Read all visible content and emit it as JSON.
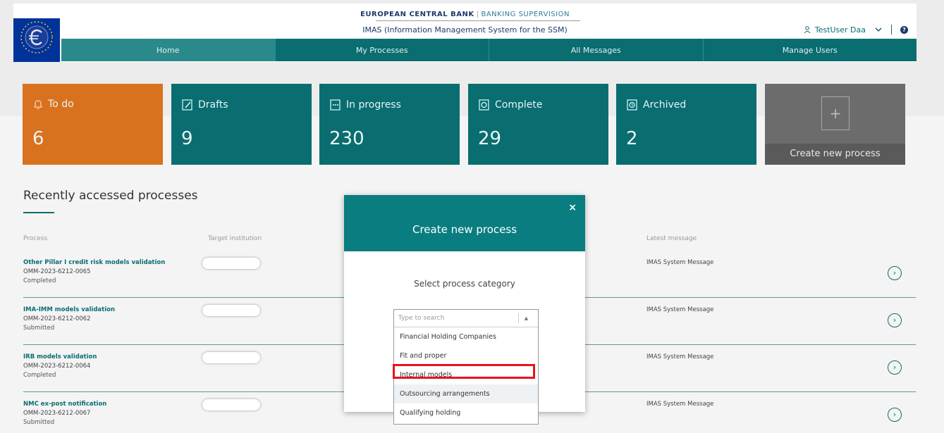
{
  "header": {
    "org": "EUROPEAN CENTRAL BANK",
    "separator": "|",
    "org_sub": "BANKING SUPERVISION",
    "app_title": "IMAS (Information Management System for the SSM)",
    "user_name": "TestUser Daa",
    "help_glyph": "?"
  },
  "nav": [
    "Home",
    "My Processes",
    "All Messages",
    "Manage Users"
  ],
  "tiles": [
    {
      "label": "To do",
      "count": "6",
      "icon": "bell-icon"
    },
    {
      "label": "Drafts",
      "count": "9",
      "icon": "drafts-icon"
    },
    {
      "label": "In progress",
      "count": "230",
      "icon": "in-progress-icon"
    },
    {
      "label": "Complete",
      "count": "29",
      "icon": "complete-icon"
    },
    {
      "label": "Archived",
      "count": "2",
      "icon": "archived-icon"
    }
  ],
  "create_tile": {
    "label": "Create new process",
    "plus": "+"
  },
  "recent": {
    "title": "Recently accessed processes",
    "columns": {
      "process": "Process",
      "target": "Target institution",
      "latest": "Latest message"
    },
    "rows": [
      {
        "name": "Other Pillar I credit risk models validation",
        "code": "OMM-2023-6212-0065",
        "status": "Completed",
        "message": "IMAS System Message"
      },
      {
        "name": "IMA-IMM models validation",
        "code": "OMM-2023-6212-0062",
        "status": "Submitted",
        "message": "IMAS System Message"
      },
      {
        "name": "IRB models validation",
        "code": "OMM-2023-6212-0064",
        "status": "Completed",
        "message": "IMAS System Message"
      },
      {
        "name": "NMC ex-post notification",
        "code": "OMM-2023-6212-0067",
        "status": "Submitted",
        "message": "IMAS System Message"
      }
    ]
  },
  "modal": {
    "title": "Create new process",
    "close": "×",
    "subtitle": "Select process category",
    "search_placeholder": "Type to search",
    "toggle": "▲",
    "options": [
      "Financial Holding Companies",
      "Fit and proper",
      "Internal models",
      "Outsourcing arrangements",
      "Qualifying holding"
    ]
  },
  "colors": {
    "teal": "#0a6d70",
    "orange": "#d8721f",
    "highlight": "#e8141b"
  }
}
